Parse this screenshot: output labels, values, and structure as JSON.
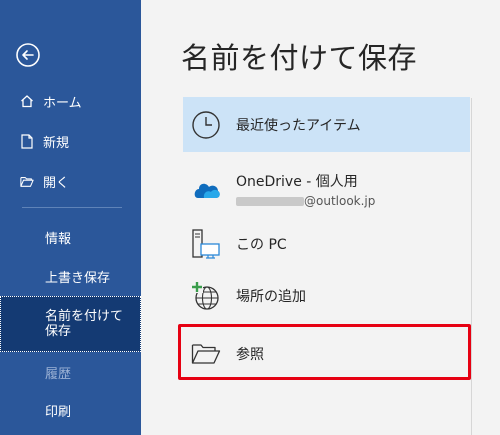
{
  "sidebar": {
    "back_label": "←",
    "home": "ホーム",
    "new": "新規",
    "open": "開く",
    "info": "情報",
    "save": "上書き保存",
    "save_as": "名前を付けて保存",
    "history": "履歴",
    "print": "印刷"
  },
  "main": {
    "title": "名前を付けて保存",
    "locations": [
      {
        "label": "最近使ったアイテム",
        "icon": "clock-icon",
        "selected": true
      },
      {
        "label": "OneDrive - 個人用",
        "sub": "@outlook.jp",
        "icon": "onedrive-cloud-icon"
      },
      {
        "label": "この PC",
        "icon": "computer-icon"
      },
      {
        "label": "場所の追加",
        "icon": "globe-add-icon"
      },
      {
        "label": "参照",
        "icon": "folder-icon",
        "highlighted": true
      }
    ]
  },
  "colors": {
    "sidebar_bg": "#2b579a",
    "sidebar_selected": "#143a73",
    "main_bg": "#f3f3f3",
    "recent_selected": "#cce3f7",
    "highlight_border": "#e60012"
  }
}
